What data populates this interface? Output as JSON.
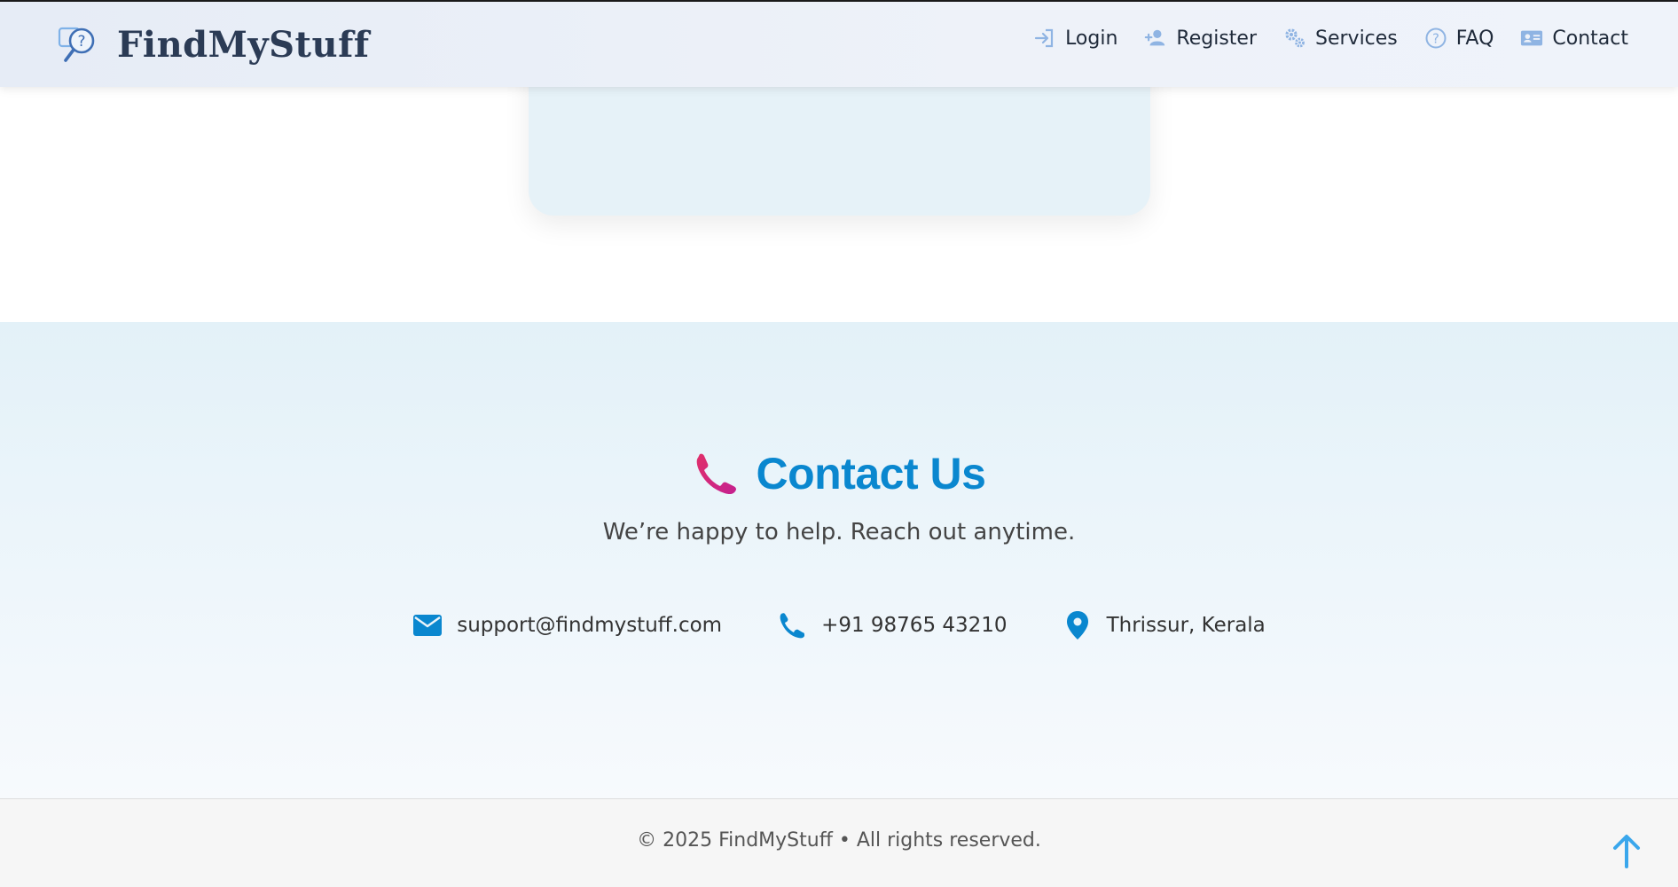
{
  "header": {
    "brand_name": "FindMyStuff",
    "logo_icon": "question-magnifier-logo",
    "nav": [
      {
        "label": "Login",
        "icon": "login-icon"
      },
      {
        "label": "Register",
        "icon": "user-plus-icon"
      },
      {
        "label": "Services",
        "icon": "gears-icon"
      },
      {
        "label": "FAQ",
        "icon": "question-circle-icon"
      },
      {
        "label": "Contact",
        "icon": "id-card-icon"
      }
    ]
  },
  "contact": {
    "title": "Contact Us",
    "title_icon": "telephone-receiver-emoji",
    "subtitle": "We’re happy to help. Reach out anytime.",
    "items": [
      {
        "icon": "envelope-icon",
        "text": "support@findmystuff.com"
      },
      {
        "icon": "phone-icon",
        "text": "+91 98765 43210"
      },
      {
        "icon": "location-pin-icon",
        "text": "Thrissur, Kerala"
      }
    ]
  },
  "footer": {
    "copyright": "© 2025 FindMyStuff • All rights reserved.",
    "back_to_top_icon": "arrow-up-icon"
  },
  "colors": {
    "accent": "#0a87cf",
    "brand_text": "#2b3b55",
    "nav_icon": "#8fb4e3",
    "back_to_top": "#3aa7ec",
    "phone_emoji": "#e0306a"
  }
}
